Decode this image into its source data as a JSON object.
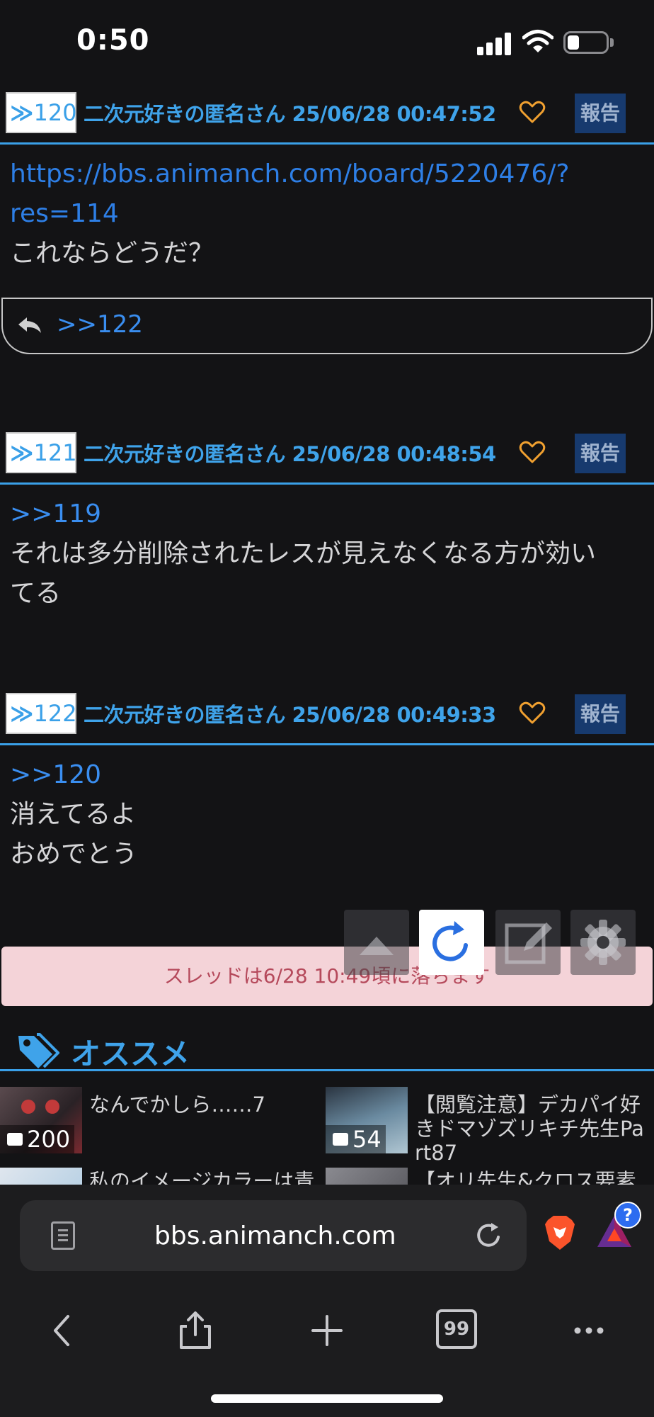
{
  "status_bar": {
    "time": "0:50"
  },
  "posts": [
    {
      "no": "120",
      "poster": "二次元好きの匿名さん",
      "datetime": "25/06/28 00:47:52",
      "report": "報告",
      "link_line1": "https://bbs.animanch.com/board/5220476/?",
      "link_line2": "res=114",
      "line1": "これならどうだ？",
      "reply": ">>122"
    },
    {
      "no": "121",
      "poster": "二次元好きの匿名さん",
      "datetime": "25/06/28 00:48:54",
      "report": "報告",
      "anchor": ">>119",
      "line1": "それは多分削除されたレスが見えなくなる方が効い",
      "line2": "てる"
    },
    {
      "no": "122",
      "poster": "二次元好きの匿名さん",
      "datetime": "25/06/28 00:49:33",
      "report": "報告",
      "anchor": ">>120",
      "line1": "消えてるよ",
      "line2": "おめでとう"
    }
  ],
  "notice": "スレッドは6/28 10:49頃に落ちます",
  "recommend": {
    "title": "オススメ",
    "items": [
      {
        "text": "なんでかしら……7",
        "count": "200"
      },
      {
        "text_line1": "【閲覧注意】デカパイ好",
        "text_line2": "きドマゾズリキチ先生Pa",
        "text_line3": "rt87",
        "count": "54"
      },
      {
        "text": "私のイメージカラーは青"
      },
      {
        "text": "【オリ先生&クロス要素"
      }
    ]
  },
  "browser": {
    "url": "bbs.animanch.com",
    "tab_count": "99",
    "badge": "?"
  },
  "icons": {
    "reply": "reply-arrow-icon",
    "heart": "heart-icon",
    "up": "scroll-up-icon",
    "reload": "reload-icon",
    "edit": "edit-icon",
    "settings": "gear-icon",
    "tag": "tag-icon"
  },
  "colors": {
    "accent": "#3aa0e8",
    "link": "#2e7fe6",
    "heart": "#f0a030",
    "notice_bg": "#f4d3d8",
    "background": "#131315"
  }
}
